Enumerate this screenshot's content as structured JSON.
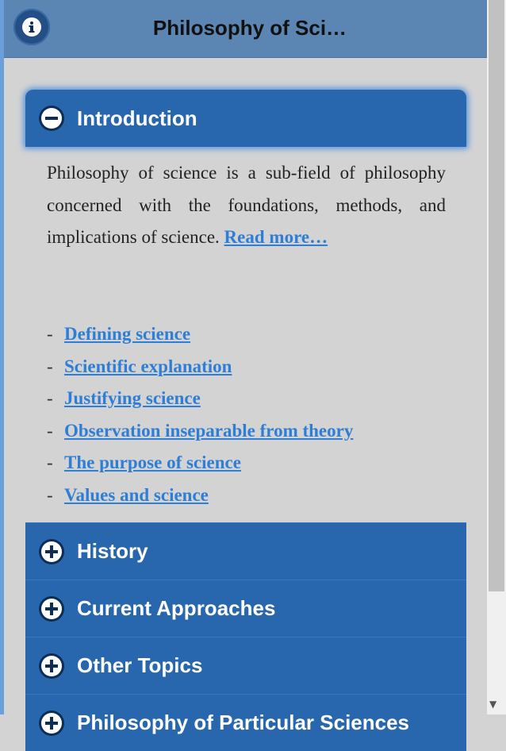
{
  "header": {
    "title": "Philosophy of Sci…",
    "info_icon": "info-icon"
  },
  "sections": [
    {
      "label": "Introduction",
      "state": "expanded",
      "icon": "minus-icon"
    },
    {
      "label": "History",
      "state": "collapsed",
      "icon": "plus-icon"
    },
    {
      "label": "Current Approaches",
      "state": "collapsed",
      "icon": "plus-icon"
    },
    {
      "label": "Other Topics",
      "state": "collapsed",
      "icon": "plus-icon"
    },
    {
      "label": "Philosophy of Particular Sciences",
      "state": "collapsed",
      "icon": "plus-icon"
    }
  ],
  "intro": {
    "text": "Philosophy of science is a sub-field of philosophy concerned with the foundations, methods, and implications of science.",
    "read_more": "Read more…"
  },
  "topics": [
    "Defining science",
    "Scientific explanation",
    "Justifying science",
    "Observation inseparable from theory",
    "The purpose of science",
    "Values and science"
  ],
  "colors": {
    "header": "#5b86b4",
    "section": "#2867ad",
    "link": "#2e7ed6",
    "background": "#d3d3d3"
  }
}
